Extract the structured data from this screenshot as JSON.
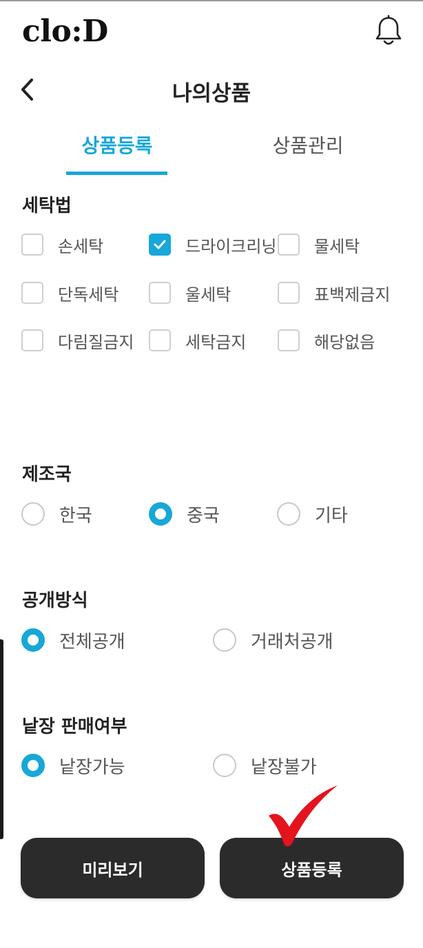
{
  "app": {
    "logo": "clo:D"
  },
  "header": {
    "title": "나의상품"
  },
  "tabs": [
    {
      "label": "상품등록",
      "active": true
    },
    {
      "label": "상품관리",
      "active": false
    }
  ],
  "washing": {
    "title": "세탁법",
    "options": [
      {
        "label": "손세탁",
        "checked": false
      },
      {
        "label": "드라이크리닝",
        "checked": true
      },
      {
        "label": "물세탁",
        "checked": false
      },
      {
        "label": "단독세탁",
        "checked": false
      },
      {
        "label": "울세탁",
        "checked": false
      },
      {
        "label": "표백제금지",
        "checked": false
      },
      {
        "label": "다림질금지",
        "checked": false
      },
      {
        "label": "세탁금지",
        "checked": false
      },
      {
        "label": "해당없음",
        "checked": false
      }
    ]
  },
  "origin": {
    "title": "제조국",
    "options": [
      {
        "label": "한국",
        "selected": false
      },
      {
        "label": "중국",
        "selected": true
      },
      {
        "label": "기타",
        "selected": false
      }
    ]
  },
  "visibility": {
    "title": "공개방식",
    "options": [
      {
        "label": "전체공개",
        "selected": true
      },
      {
        "label": "거래처공개",
        "selected": false
      }
    ]
  },
  "single_sale": {
    "title": "낱장 판매여부",
    "options": [
      {
        "label": "낱장가능",
        "selected": true
      },
      {
        "label": "낱장불가",
        "selected": false
      }
    ]
  },
  "buttons": {
    "preview": "미리보기",
    "register": "상품등록"
  },
  "colors": {
    "accent": "#17a7d8",
    "button_bg": "#2b2b2b",
    "annotation": "#e4141e"
  },
  "icons": {
    "notification": "bell-icon",
    "back": "back-chevron-icon",
    "checkmark": "check-icon"
  }
}
